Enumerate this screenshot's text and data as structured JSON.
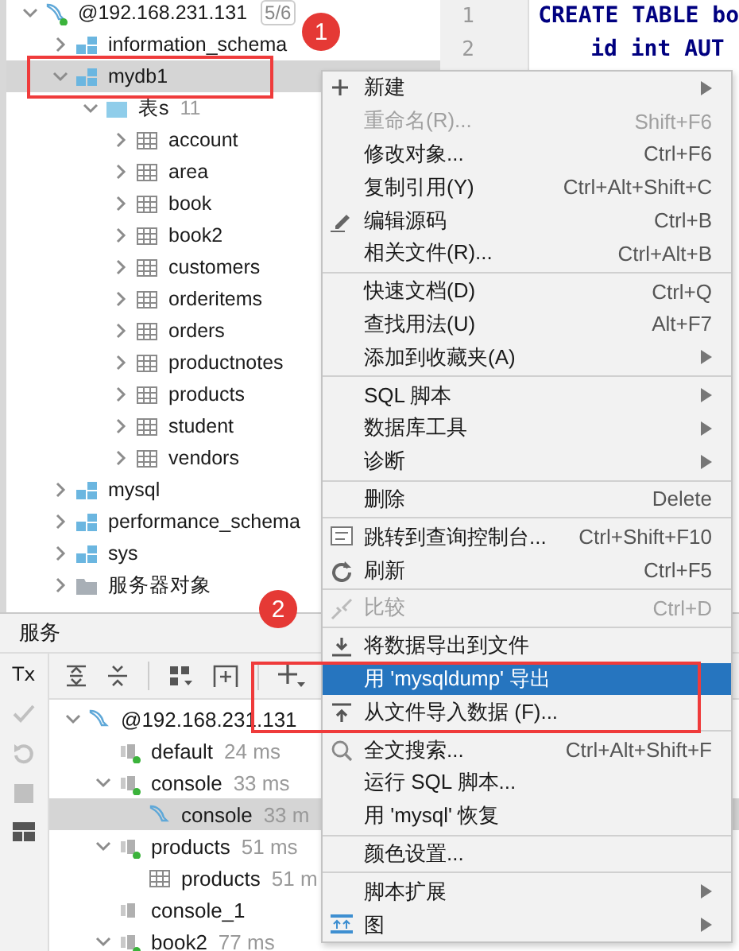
{
  "database_tree": {
    "items": [
      {
        "kind": "server",
        "name": "@192.168.231.131",
        "count": "5/6",
        "connected": true,
        "expanded": true,
        "selected": false,
        "children": [
          {
            "kind": "schema",
            "name": "information_schema",
            "expanded": false,
            "selected": false
          },
          {
            "kind": "schema",
            "name": "mydb1",
            "expanded": true,
            "selected": true,
            "children": [
              {
                "kind": "tables",
                "name": "表s",
                "count": "11",
                "expanded": true,
                "selected": false,
                "children": [
                  {
                    "kind": "table",
                    "name": "account",
                    "expanded": false,
                    "selected": false
                  },
                  {
                    "kind": "table",
                    "name": "area",
                    "expanded": false,
                    "selected": false
                  },
                  {
                    "kind": "table",
                    "name": "book",
                    "expanded": false,
                    "selected": false
                  },
                  {
                    "kind": "table",
                    "name": "book2",
                    "expanded": false,
                    "selected": false
                  },
                  {
                    "kind": "table",
                    "name": "customers",
                    "expanded": false,
                    "selected": false
                  },
                  {
                    "kind": "table",
                    "name": "orderitems",
                    "expanded": false,
                    "selected": false
                  },
                  {
                    "kind": "table",
                    "name": "orders",
                    "expanded": false,
                    "selected": false
                  },
                  {
                    "kind": "table",
                    "name": "productnotes",
                    "expanded": false,
                    "selected": false
                  },
                  {
                    "kind": "table",
                    "name": "products",
                    "expanded": false,
                    "selected": false
                  },
                  {
                    "kind": "table",
                    "name": "student",
                    "expanded": false,
                    "selected": false
                  },
                  {
                    "kind": "table",
                    "name": "vendors",
                    "expanded": false,
                    "selected": false
                  }
                ]
              }
            ]
          },
          {
            "kind": "schema",
            "name": "mysql",
            "expanded": false,
            "selected": false
          },
          {
            "kind": "schema",
            "name": "performance_schema",
            "expanded": false,
            "selected": false
          },
          {
            "kind": "schema",
            "name": "sys",
            "expanded": false,
            "selected": false
          },
          {
            "kind": "folder",
            "name": "服务器对象",
            "expanded": false,
            "selected": false
          }
        ]
      }
    ]
  },
  "editor": {
    "lines": [
      {
        "number": "1",
        "code": "CREATE TABLE bo",
        "indent": false
      },
      {
        "number": "2",
        "code": "id int AUT",
        "indent": true
      }
    ]
  },
  "services": {
    "title": "服务",
    "tx_label": "Tx",
    "items": [
      {
        "kind": "server",
        "name": "@192.168.231.131",
        "connected": false,
        "expanded": true,
        "selected": false,
        "children": [
          {
            "kind": "session",
            "name": "default",
            "time": "24 ms",
            "connected": true,
            "selected": false
          },
          {
            "kind": "session",
            "name": "console",
            "time": "33 ms",
            "connected": true,
            "expanded": true,
            "selected": false,
            "children": [
              {
                "kind": "console",
                "name": "console",
                "time": "33 m",
                "selected": true
              }
            ]
          },
          {
            "kind": "session",
            "name": "products",
            "time": "51 ms",
            "connected": true,
            "expanded": true,
            "selected": false,
            "children": [
              {
                "kind": "table",
                "name": "products",
                "time": "51 m",
                "selected": false
              }
            ]
          },
          {
            "kind": "session",
            "name": "console_1",
            "connected": false,
            "selected": false
          },
          {
            "kind": "session",
            "name": "book2",
            "time": "77 ms",
            "connected": true,
            "expanded": true,
            "selected": false
          }
        ]
      }
    ]
  },
  "context_menu": {
    "groups": [
      [
        {
          "label": "新建",
          "submenu": true,
          "disabled": false,
          "selected": false
        },
        {
          "label": "重命名(R)...",
          "shortcut": "Shift+F6",
          "submenu": false,
          "disabled": true,
          "selected": false
        },
        {
          "label": "修改对象...",
          "shortcut": "Ctrl+F6",
          "submenu": false,
          "disabled": false,
          "selected": false
        },
        {
          "label": "复制引用(Y)",
          "shortcut": "Ctrl+Alt+Shift+C",
          "submenu": false,
          "disabled": false,
          "selected": false
        },
        {
          "label": "编辑源码",
          "shortcut": "Ctrl+B",
          "submenu": false,
          "disabled": false,
          "selected": false
        },
        {
          "label": "相关文件(R)...",
          "shortcut": "Ctrl+Alt+B",
          "submenu": false,
          "disabled": false,
          "selected": false
        }
      ],
      [
        {
          "label": "快速文档(D)",
          "shortcut": "Ctrl+Q",
          "submenu": false,
          "disabled": false,
          "selected": false
        },
        {
          "label": "查找用法(U)",
          "shortcut": "Alt+F7",
          "submenu": false,
          "disabled": false,
          "selected": false
        },
        {
          "label": "添加到收藏夹(A)",
          "submenu": true,
          "disabled": false,
          "selected": false
        }
      ],
      [
        {
          "label": "SQL 脚本",
          "submenu": true,
          "disabled": false,
          "selected": false
        },
        {
          "label": "数据库工具",
          "submenu": true,
          "disabled": false,
          "selected": false
        },
        {
          "label": "诊断",
          "submenu": true,
          "disabled": false,
          "selected": false
        }
      ],
      [
        {
          "label": "删除",
          "shortcut": "Delete",
          "submenu": false,
          "disabled": false,
          "selected": false
        }
      ],
      [
        {
          "label": "跳转到查询控制台...",
          "shortcut": "Ctrl+Shift+F10",
          "submenu": false,
          "disabled": false,
          "selected": false
        },
        {
          "label": "刷新",
          "shortcut": "Ctrl+F5",
          "submenu": false,
          "disabled": false,
          "selected": false
        }
      ],
      [
        {
          "label": "比较",
          "shortcut": "Ctrl+D",
          "submenu": false,
          "disabled": true,
          "selected": false
        }
      ],
      [
        {
          "label": "将数据导出到文件",
          "submenu": false,
          "disabled": false,
          "selected": false
        },
        {
          "label": "用 'mysqldump' 导出",
          "submenu": false,
          "disabled": false,
          "selected": true
        },
        {
          "label": "从文件导入数据 (F)...",
          "submenu": false,
          "disabled": false,
          "selected": false
        }
      ],
      [
        {
          "label": "全文搜索...",
          "shortcut": "Ctrl+Alt+Shift+F",
          "submenu": false,
          "disabled": false,
          "selected": false
        },
        {
          "label": "运行 SQL 脚本...",
          "submenu": false,
          "disabled": false,
          "selected": false
        },
        {
          "label": "用 'mysql' 恢复",
          "submenu": false,
          "disabled": false,
          "selected": false
        }
      ],
      [
        {
          "label": "颜色设置...",
          "submenu": false,
          "disabled": false,
          "selected": false
        }
      ],
      [
        {
          "label": "脚本扩展",
          "submenu": true,
          "disabled": false,
          "selected": false
        },
        {
          "label": "图",
          "submenu": true,
          "disabled": false,
          "selected": false
        }
      ]
    ]
  },
  "annotations": [
    {
      "label": "1"
    },
    {
      "label": "2"
    }
  ]
}
